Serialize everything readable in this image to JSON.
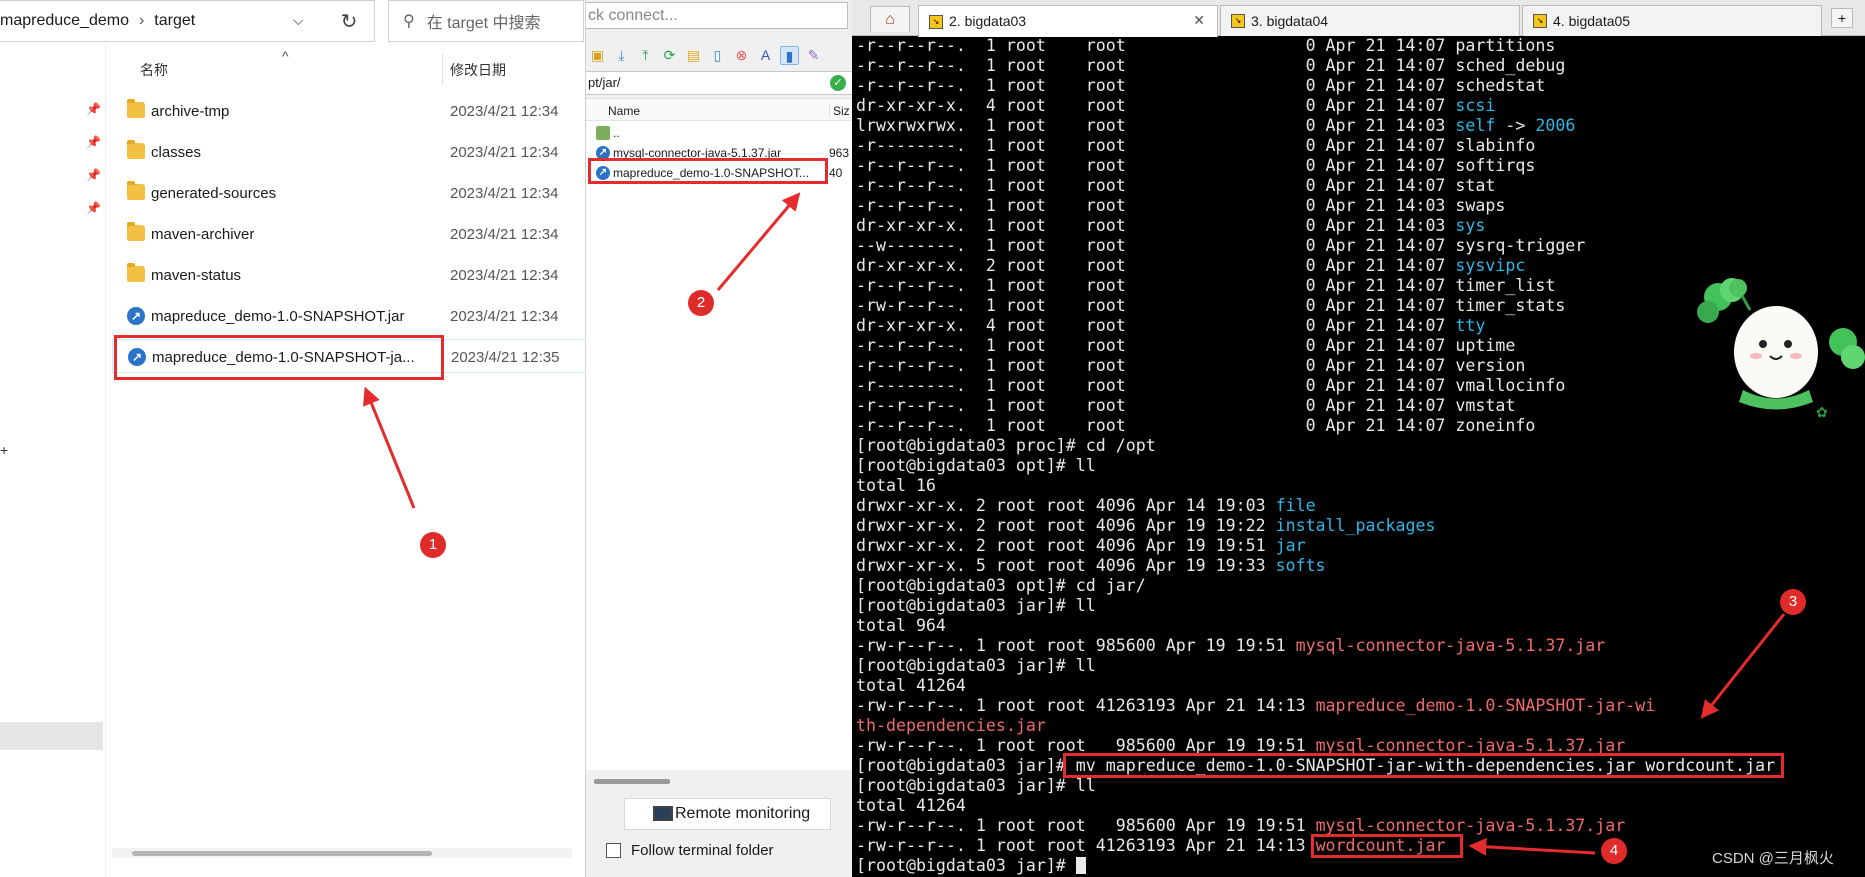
{
  "explorer": {
    "breadcrumb": [
      "mapreduce_demo",
      "target"
    ],
    "breadcrumb_sep": "›",
    "search_placeholder": "在 target 中搜索",
    "columns": {
      "name": "名称",
      "date": "修改日期"
    },
    "rows": [
      {
        "name": "archive-tmp",
        "date": "2023/4/21 12:34",
        "type": "folder"
      },
      {
        "name": "classes",
        "date": "2023/4/21 12:34",
        "type": "folder"
      },
      {
        "name": "generated-sources",
        "date": "2023/4/21 12:34",
        "type": "folder"
      },
      {
        "name": "maven-archiver",
        "date": "2023/4/21 12:34",
        "type": "folder"
      },
      {
        "name": "maven-status",
        "date": "2023/4/21 12:34",
        "type": "folder"
      },
      {
        "name": "mapreduce_demo-1.0-SNAPSHOT.jar",
        "date": "2023/4/21 12:34",
        "type": "jar"
      },
      {
        "name": "mapreduce_demo-1.0-SNAPSHOT-ja...",
        "date": "2023/4/21 12:35",
        "type": "jar"
      }
    ]
  },
  "sftp": {
    "quick_connect": "ck connect...",
    "path": "pt/jar/",
    "columns": {
      "name": "Name",
      "size": "Siz"
    },
    "rows": [
      {
        "name": "..",
        "size": ""
      },
      {
        "name": "mysql-connector-java-5.1.37.jar",
        "size": "963"
      },
      {
        "name": "mapreduce_demo-1.0-SNAPSHOT...",
        "size": "40"
      }
    ],
    "remote_monitoring": "Remote monitoring",
    "follow_terminal_folder": "Follow terminal folder"
  },
  "terminal": {
    "tabs": [
      {
        "label": "2. bigdata03",
        "active": true
      },
      {
        "label": "3. bigdata04",
        "active": false
      },
      {
        "label": "4. bigdata05",
        "active": false
      }
    ],
    "lines": [
      [
        [
          "-r--r--r--.  1 root    root                  0 Apr 21 14:07 partitions",
          ""
        ]
      ],
      [
        [
          "-r--r--r--.  1 root    root                  0 Apr 21 14:07 sched_debug",
          ""
        ]
      ],
      [
        [
          "-r--r--r--.  1 root    root                  0 Apr 21 14:07 schedstat",
          ""
        ]
      ],
      [
        [
          "dr-xr-xr-x.  4 root    root                  0 Apr 21 14:07 ",
          ""
        ],
        [
          "scsi",
          "cyan"
        ]
      ],
      [
        [
          "lrwxrwxrwx.  1 root    root                  0 Apr 21 14:03 ",
          ""
        ],
        [
          "self",
          "cyan"
        ],
        [
          " -> ",
          ""
        ],
        [
          "2006",
          "cyan"
        ]
      ],
      [
        [
          "-r--------.  1 root    root                  0 Apr 21 14:07 slabinfo",
          ""
        ]
      ],
      [
        [
          "-r--r--r--.  1 root    root                  0 Apr 21 14:07 softirqs",
          ""
        ]
      ],
      [
        [
          "-r--r--r--.  1 root    root                  0 Apr 21 14:07 stat",
          ""
        ]
      ],
      [
        [
          "-r--r--r--.  1 root    root                  0 Apr 21 14:03 swaps",
          ""
        ]
      ],
      [
        [
          "dr-xr-xr-x.  1 root    root                  0 Apr 21 14:03 ",
          ""
        ],
        [
          "sys",
          "cyan"
        ]
      ],
      [
        [
          "--w-------.  1 root    root                  0 Apr 21 14:07 sysrq-trigger",
          ""
        ]
      ],
      [
        [
          "dr-xr-xr-x.  2 root    root                  0 Apr 21 14:07 ",
          ""
        ],
        [
          "sysvipc",
          "cyan"
        ]
      ],
      [
        [
          "-r--r--r--.  1 root    root                  0 Apr 21 14:07 timer_list",
          ""
        ]
      ],
      [
        [
          "-rw-r--r--.  1 root    root                  0 Apr 21 14:07 timer_stats",
          ""
        ]
      ],
      [
        [
          "dr-xr-xr-x.  4 root    root                  0 Apr 21 14:07 ",
          ""
        ],
        [
          "tty",
          "cyan"
        ]
      ],
      [
        [
          "-r--r--r--.  1 root    root                  0 Apr 21 14:07 uptime",
          ""
        ]
      ],
      [
        [
          "-r--r--r--.  1 root    root                  0 Apr 21 14:07 version",
          ""
        ]
      ],
      [
        [
          "-r--------.  1 root    root                  0 Apr 21 14:07 vmallocinfo",
          ""
        ]
      ],
      [
        [
          "-r--r--r--.  1 root    root                  0 Apr 21 14:07 vmstat",
          ""
        ]
      ],
      [
        [
          "-r--r--r--.  1 root    root                  0 Apr 21 14:07 zoneinfo",
          ""
        ]
      ],
      [
        [
          "[root@bigdata03 proc]# cd /opt",
          ""
        ]
      ],
      [
        [
          "[root@bigdata03 opt]# ll",
          ""
        ]
      ],
      [
        [
          "total 16",
          ""
        ]
      ],
      [
        [
          "drwxr-xr-x. 2 root root 4096 Apr 14 19:03 ",
          ""
        ],
        [
          "file",
          "cyan"
        ]
      ],
      [
        [
          "drwxr-xr-x. 2 root root 4096 Apr 19 19:22 ",
          ""
        ],
        [
          "install_packages",
          "cyan"
        ]
      ],
      [
        [
          "drwxr-xr-x. 2 root root 4096 Apr 19 19:51 ",
          ""
        ],
        [
          "jar",
          "cyan"
        ]
      ],
      [
        [
          "drwxr-xr-x. 5 root root 4096 Apr 19 19:33 ",
          ""
        ],
        [
          "softs",
          "cyan"
        ]
      ],
      [
        [
          "[root@bigdata03 opt]# cd jar/",
          ""
        ]
      ],
      [
        [
          "[root@bigdata03 jar]# ll",
          ""
        ]
      ],
      [
        [
          "total 964",
          ""
        ]
      ],
      [
        [
          "-rw-r--r--. 1 root root 985600 Apr 19 19:51 ",
          ""
        ],
        [
          "mysql-connector-java-5.1.37.jar",
          "salmon"
        ]
      ],
      [
        [
          "[root@bigdata03 jar]# ll",
          ""
        ]
      ],
      [
        [
          "total 41264",
          ""
        ]
      ],
      [
        [
          "-rw-r--r--. 1 root root 41263193 Apr 21 14:13 ",
          ""
        ],
        [
          "mapreduce_demo-1.0-SNAPSHOT-jar-wi",
          "salmon"
        ]
      ],
      [
        [
          "th-dependencies.jar",
          "salmon"
        ]
      ],
      [
        [
          "-rw-r--r--. 1 root root   985600 Apr 19 19:51 ",
          ""
        ],
        [
          "mysql-connector-java-5.1.37.jar",
          "salmon"
        ]
      ],
      [
        [
          "[root@bigdata03 jar]# mv mapreduce_demo-1.0-SNAPSHOT-jar-with-dependencies.jar wordcount.jar",
          ""
        ]
      ],
      [
        [
          "[root@bigdata03 jar]# ll",
          ""
        ]
      ],
      [
        [
          "total 41264",
          ""
        ]
      ],
      [
        [
          "-rw-r--r--. 1 root root   985600 Apr 19 19:51 ",
          ""
        ],
        [
          "mysql-connector-java-5.1.37.jar",
          "salmon"
        ]
      ],
      [
        [
          "-rw-r--r--. 1 root root 41263193 Apr 21 14:13 ",
          ""
        ],
        [
          "wordcount.jar",
          "salmon"
        ]
      ],
      [
        [
          "[root@bigdata03 jar]# ",
          ""
        ]
      ]
    ]
  },
  "annotations": {
    "badges": [
      "1",
      "2",
      "3",
      "4"
    ],
    "color": "#e42c2c"
  },
  "watermark": "CSDN @三月枫火"
}
